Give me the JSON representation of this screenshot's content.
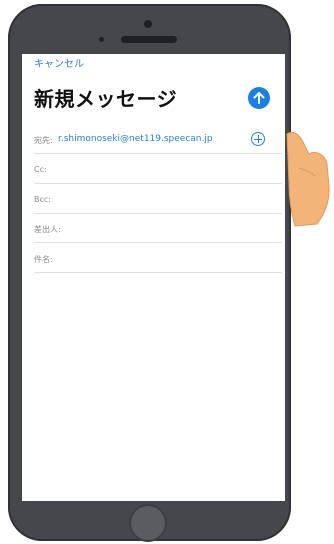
{
  "header": {
    "cancel_label": "キャンセル",
    "title": "新規メッセージ"
  },
  "fields": {
    "to_label": "宛先:",
    "to_value": "r.shimonoseki@net119.speecan.jp",
    "cc_label": "Cc:",
    "bcc_label": "Bcc:",
    "from_label": "差出人:",
    "subject_label": "件名:"
  },
  "icons": {
    "send": "arrow-up-circle-icon",
    "add_recipient": "plus-circle-icon"
  },
  "colors": {
    "accent": "#1e7fe0",
    "link": "#2d7fd0",
    "phone_body": "#45474b",
    "hand": "#f3b47a"
  }
}
